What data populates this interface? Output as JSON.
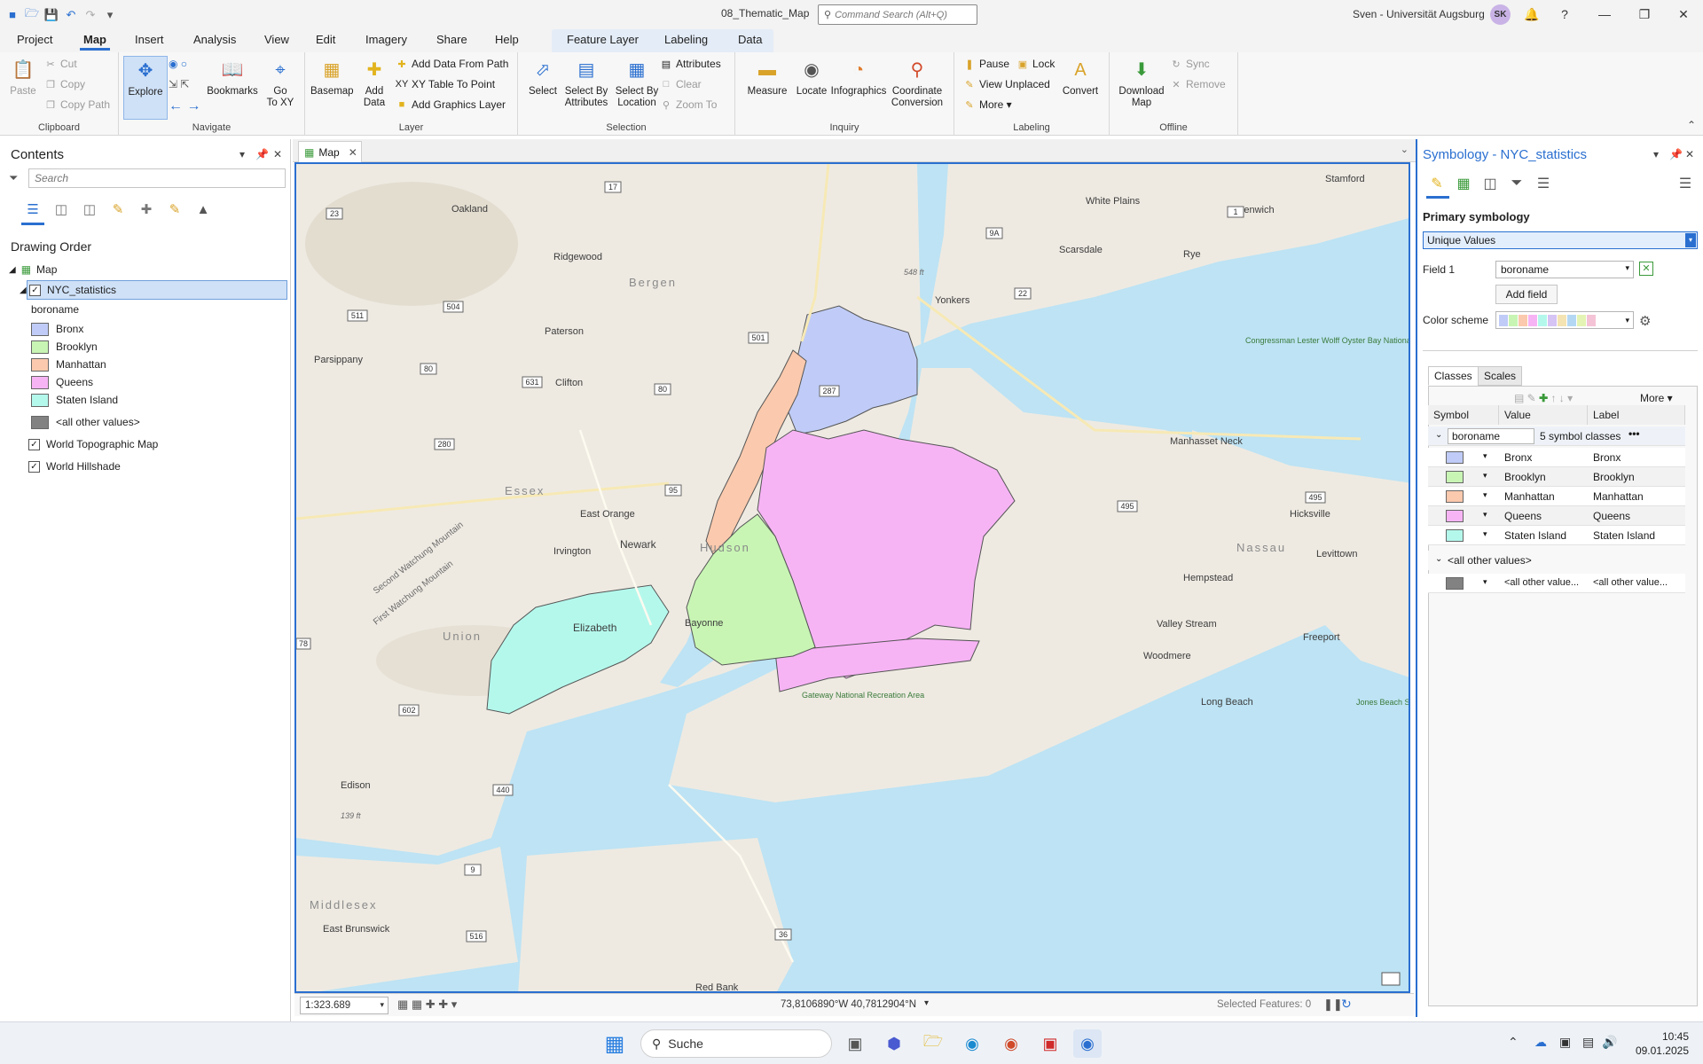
{
  "titlebar": {
    "doc_title": "08_Thematic_Map",
    "command_search_placeholder": "Command Search (Alt+Q)",
    "user_name": "Sven - Universität Augsburg",
    "avatar_initials": "SK"
  },
  "ribbon": {
    "tabs": [
      "Project",
      "Map",
      "Insert",
      "Analysis",
      "View",
      "Edit",
      "Imagery",
      "Share",
      "Help"
    ],
    "context_tabs": [
      "Feature Layer",
      "Labeling",
      "Data"
    ],
    "groups": {
      "clipboard": {
        "label": "Clipboard",
        "paste": "Paste",
        "cut": "Cut",
        "copy": "Copy",
        "copy_path": "Copy Path"
      },
      "navigate": {
        "label": "Navigate",
        "explore": "Explore",
        "bookmarks": "Bookmarks",
        "go_to_xy_1": "Go",
        "go_to_xy_2": "To XY"
      },
      "layer": {
        "label": "Layer",
        "basemap": "Basemap",
        "add_data_1": "Add",
        "add_data_2": "Data",
        "add_data_from_path": "Add Data From Path",
        "xy_table": "XY Table To Point",
        "add_graphics": "Add Graphics Layer"
      },
      "selection": {
        "label": "Selection",
        "select": "Select",
        "select_attr_1": "Select By",
        "select_attr_2": "Attributes",
        "select_loc_1": "Select By",
        "select_loc_2": "Location",
        "attributes": "Attributes",
        "clear": "Clear",
        "zoom_to": "Zoom To"
      },
      "inquiry": {
        "label": "Inquiry",
        "measure": "Measure",
        "locate": "Locate",
        "infographics": "Infographics",
        "coord_1": "Coordinate",
        "coord_2": "Conversion"
      },
      "labeling": {
        "label": "Labeling",
        "pause": "Pause",
        "lock": "Lock",
        "view_unplaced": "View Unplaced",
        "more": "More",
        "convert": "Convert"
      },
      "offline": {
        "label": "Offline",
        "download_1": "Download",
        "download_2": "Map",
        "sync": "Sync",
        "remove": "Remove"
      }
    }
  },
  "contents": {
    "title": "Contents",
    "search_placeholder": "Search",
    "drawing_order": "Drawing Order",
    "map_name": "Map",
    "layer_name": "NYC_statistics",
    "field_name": "boroname",
    "classes": [
      {
        "label": "Bronx",
        "color": "#c0ccf7"
      },
      {
        "label": "Brooklyn",
        "color": "#c8f5b4"
      },
      {
        "label": "Manhattan",
        "color": "#fbc9ad"
      },
      {
        "label": "Queens",
        "color": "#f7b4f5"
      },
      {
        "label": "Staten Island",
        "color": "#b4f8ec"
      }
    ],
    "other_values": "<all other values>",
    "other_color": "#828282",
    "basemap_layers": [
      "World Topographic Map",
      "World Hillshade"
    ]
  },
  "map": {
    "tab_label": "Map",
    "scale": "1:323.689",
    "coordinates": "73,8106890°W 40,7812904°N",
    "selected_features": "Selected Features: 0",
    "water_color": "#bde3f4",
    "land_color": "#eeeae2",
    "labels": [
      {
        "text": "Stamford",
        "kind": "city"
      },
      {
        "text": "White Plains",
        "kind": "city"
      },
      {
        "text": "Greenwich",
        "kind": "city"
      },
      {
        "text": "Scarsdale",
        "kind": "city"
      },
      {
        "text": "Rye",
        "kind": "city"
      },
      {
        "text": "Oakland",
        "kind": "city"
      },
      {
        "text": "Ridgewood",
        "kind": "city"
      },
      {
        "text": "Bergen",
        "kind": "county"
      },
      {
        "text": "Yonkers",
        "kind": "city"
      },
      {
        "text": "Paterson",
        "kind": "city"
      },
      {
        "text": "Parsippany",
        "kind": "city"
      },
      {
        "text": "Clifton",
        "kind": "city"
      },
      {
        "text": "Congressman Lester Wolff Oyster Bay National Wildlife Refuge",
        "kind": "park"
      },
      {
        "text": "Manhasset Neck",
        "kind": "area"
      },
      {
        "text": "Essex",
        "kind": "county"
      },
      {
        "text": "East Orange",
        "kind": "city"
      },
      {
        "text": "Hicksville",
        "kind": "city"
      },
      {
        "text": "Second Watchung Mountain",
        "kind": "area"
      },
      {
        "text": "First Watchung Mountain",
        "kind": "area"
      },
      {
        "text": "Irvington",
        "kind": "city"
      },
      {
        "text": "Newark",
        "kind": "city"
      },
      {
        "text": "Hudson",
        "kind": "county"
      },
      {
        "text": "Nassau",
        "kind": "county"
      },
      {
        "text": "Levittown",
        "kind": "city"
      },
      {
        "text": "Hempstead",
        "kind": "city"
      },
      {
        "text": "Union",
        "kind": "county"
      },
      {
        "text": "Elizabeth",
        "kind": "city"
      },
      {
        "text": "Bayonne",
        "kind": "city"
      },
      {
        "text": "Valley Stream",
        "kind": "city"
      },
      {
        "text": "Freeport",
        "kind": "city"
      },
      {
        "text": "Woodmere",
        "kind": "city"
      },
      {
        "text": "Long Beach",
        "kind": "city"
      },
      {
        "text": "Jones Beach State Park",
        "kind": "park"
      },
      {
        "text": "Edison",
        "kind": "city"
      },
      {
        "text": "139 ft",
        "kind": "elev"
      },
      {
        "text": "548 ft",
        "kind": "elev"
      },
      {
        "text": "Middlesex",
        "kind": "county"
      },
      {
        "text": "East Brunswick",
        "kind": "city"
      },
      {
        "text": "Red Bank",
        "kind": "city"
      },
      {
        "text": "Gateway National Recreation Area",
        "kind": "park"
      }
    ],
    "shields": [
      "23",
      "17",
      "9A",
      "1",
      "504",
      "511",
      "501",
      "22",
      "80",
      "631",
      "80",
      "287",
      "280",
      "95",
      "495",
      "495",
      "78",
      "602",
      "440",
      "9",
      "516",
      "36"
    ]
  },
  "symbology": {
    "title": "Symbology - NYC_statistics",
    "primary_label": "Primary symbology",
    "method": "Unique Values",
    "field1_label": "Field 1",
    "field1_value": "boroname",
    "add_field": "Add field",
    "color_scheme_label": "Color scheme",
    "tabs": [
      "Classes",
      "Scales"
    ],
    "more_label": "More",
    "columns": [
      "Symbol",
      "Value",
      "Label"
    ],
    "group_field": "boroname",
    "group_count": "5 symbol classes",
    "rows": [
      {
        "value": "Bronx",
        "label": "Bronx",
        "color": "#c0ccf7"
      },
      {
        "value": "Brooklyn",
        "label": "Brooklyn",
        "color": "#c8f5b4"
      },
      {
        "value": "Manhattan",
        "label": "Manhattan",
        "color": "#fbc9ad"
      },
      {
        "value": "Queens",
        "label": "Queens",
        "color": "#f7b4f5"
      },
      {
        "value": "Staten Island",
        "label": "Staten Island",
        "color": "#b4f8ec"
      }
    ],
    "other_group": "<all other values>",
    "other_row": {
      "value": "<all other value...",
      "label": "<all other value...",
      "color": "#828282"
    }
  },
  "taskbar": {
    "search": "Suche",
    "time": "10:45",
    "date": "09.01.2025"
  }
}
